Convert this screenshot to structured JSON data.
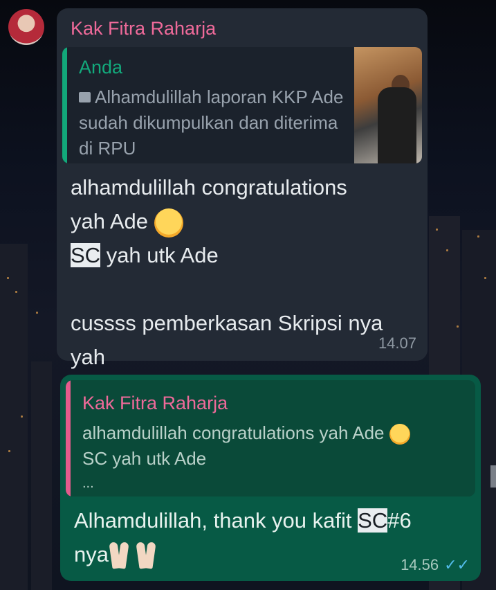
{
  "incoming": {
    "sender": "Kak Fitra Raharja",
    "quote": {
      "author": "Anda",
      "text": "Alhamdulillah laporan KKP Ade sudah dikumpulkan dan diterima di RPU",
      "thumbnail_icon": "photo-icon"
    },
    "message": {
      "line1": "alhamdulillah congratulations",
      "line2": "yah Ade",
      "sc": "SC",
      "line3_rest": " yah utk Ade",
      "line4": "cussss pemberkasan Skripsi nya",
      "line5": "yah"
    },
    "time": "14.07"
  },
  "outgoing": {
    "quote": {
      "author": "Kak Fitra Raharja",
      "line1": "alhamdulillah congratulations yah Ade",
      "line2": "SC yah utk Ade",
      "ellipsis": "..."
    },
    "message": {
      "part1": "Alhamdulillah, thank you  kafit ",
      "sc": "SC",
      "part2": "#6",
      "line2": "nya"
    },
    "time": "14.56",
    "status_icon": "double-check-icon"
  },
  "colors": {
    "incoming_bubble": "#232a35",
    "outgoing_bubble": "#075a45",
    "sender_name": "#ef6a9a",
    "you_name": "#13a97c",
    "read_ticks": "#53bdeb"
  }
}
